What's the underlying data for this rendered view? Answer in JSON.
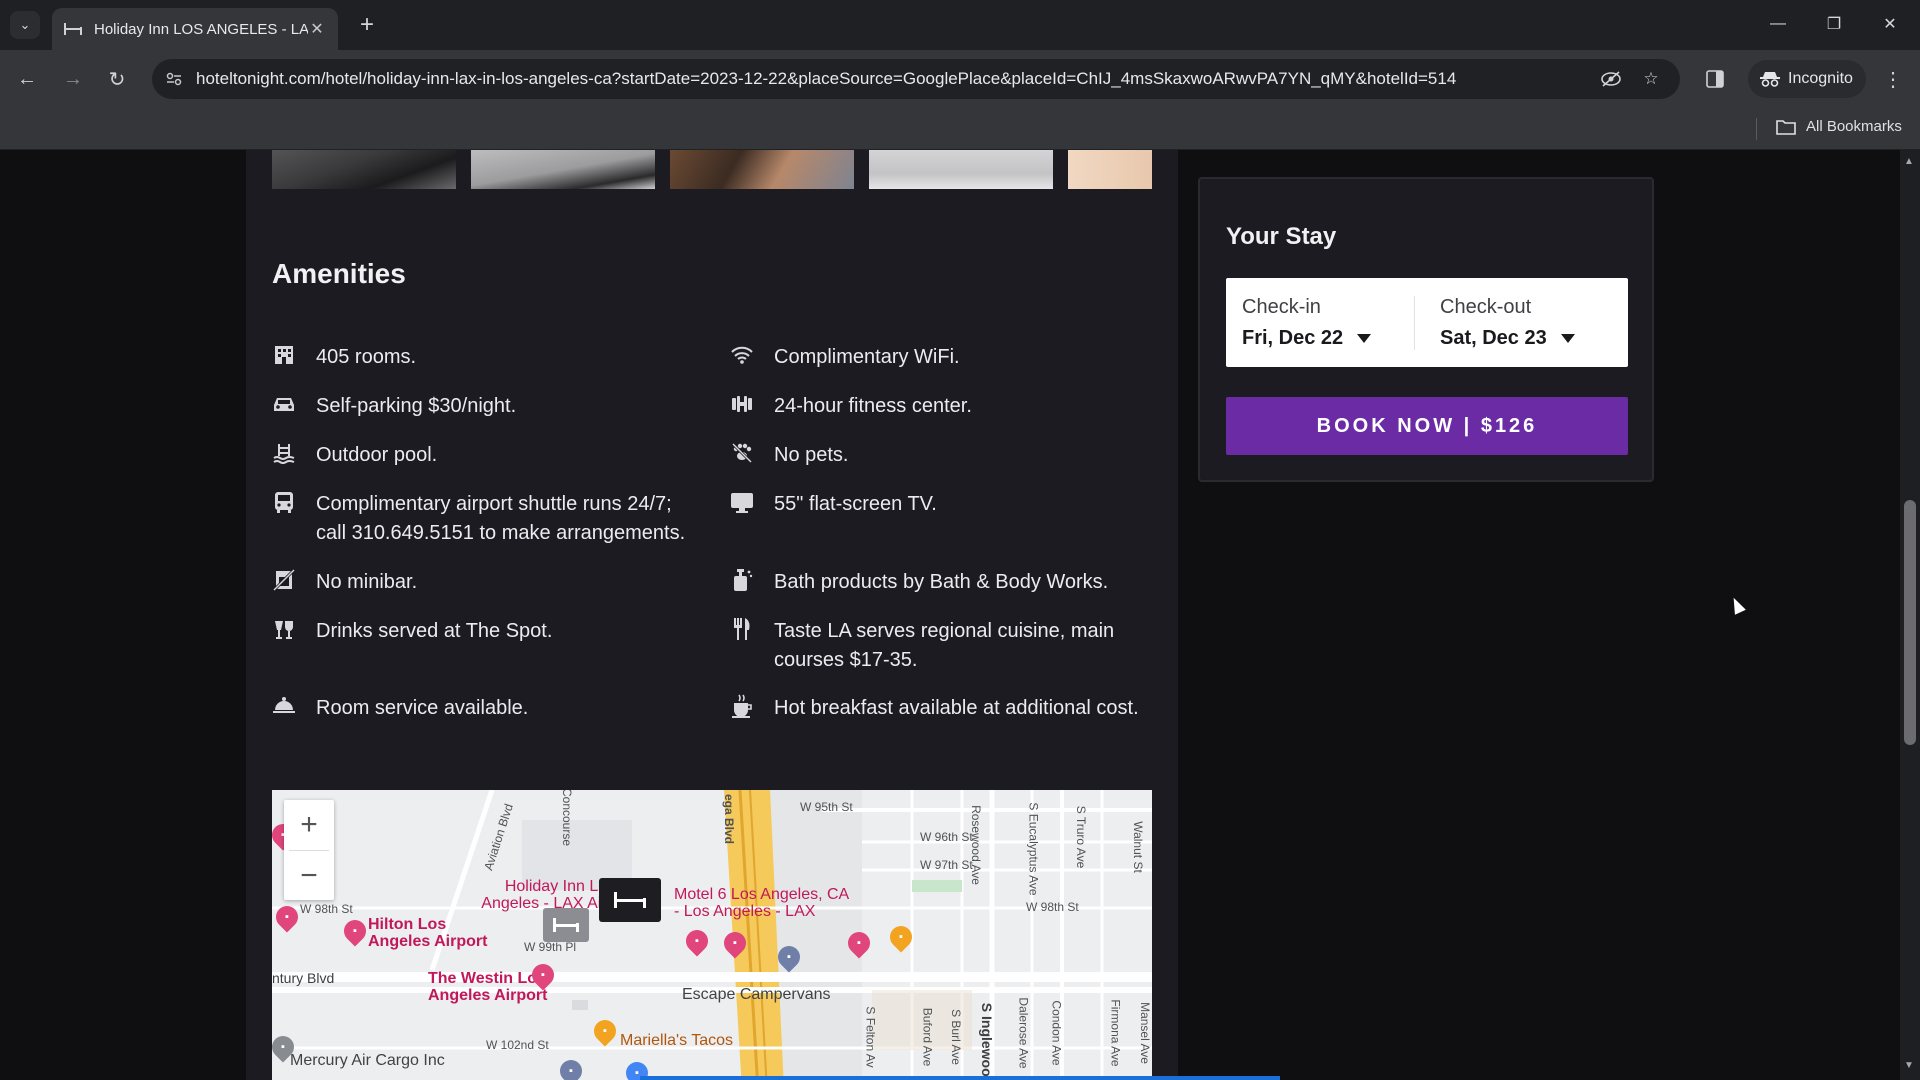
{
  "browser": {
    "tab_title": "Holiday Inn LOS ANGELES - LA",
    "url": "hoteltonight.com/hotel/holiday-inn-lax-in-los-angeles-ca?startDate=2023-12-22&placeSource=GooglePlace&placeId=ChIJ_4msSkaxwoARwvPA7YN_qMY&hotelId=514",
    "incognito_label": "Incognito",
    "all_bookmarks_label": "All Bookmarks"
  },
  "amenities": {
    "title": "Amenities",
    "items": [
      {
        "text": "405 rooms.",
        "icon": "building-icon"
      },
      {
        "text": "Complimentary WiFi.",
        "icon": "wifi-icon"
      },
      {
        "text": "Self-parking $30/night.",
        "icon": "car-icon"
      },
      {
        "text": "24-hour fitness center.",
        "icon": "dumbbell-icon"
      },
      {
        "text": "Outdoor pool.",
        "icon": "pool-icon"
      },
      {
        "text": "No pets.",
        "icon": "no-pets-icon"
      },
      {
        "text": "Complimentary airport shuttle runs 24/7; call 310.649.5151 to make arrangements.",
        "icon": "bus-icon"
      },
      {
        "text": "55\" flat-screen TV.",
        "icon": "tv-icon"
      },
      {
        "text": "No minibar.",
        "icon": "no-minibar-icon"
      },
      {
        "text": "Bath products by Bath & Body Works.",
        "icon": "soap-bottle-icon"
      },
      {
        "text": "Drinks served at The Spot.",
        "icon": "drinks-icon"
      },
      {
        "text": "Taste LA serves regional cuisine, main courses $17-35.",
        "icon": "fork-knife-icon"
      },
      {
        "text": "Room service available.",
        "icon": "cloche-icon"
      },
      {
        "text": "Hot breakfast available at additional cost.",
        "icon": "coffee-icon"
      }
    ]
  },
  "map": {
    "streets": [
      "Aviation Blvd",
      "Concourse",
      "ega Blvd",
      "W 95th St",
      "W 96th St",
      "W 97th St",
      "Rosewood Ave",
      "S Eucalyptus Ave",
      "S Truro Ave",
      "Walnut St",
      "W 98th St",
      "W 98th St",
      "W 99th Pl",
      "ntury Blvd",
      "W 102nd St",
      "S Felton Av",
      "Buford Ave",
      "S Burl Ave",
      "S Inglewood",
      "Dalerose Ave",
      "Condon Ave",
      "Firmona Ave",
      "Mansel Ave"
    ],
    "pois": {
      "holiday_inn": "Holiday Inn Los Angeles - LAX Airport, a",
      "motel6": "Motel 6 Los Angeles, CA - Los Angeles - LAX",
      "hilton": "Hilton Los Angeles Airport",
      "westin": "The Westin Los Angeles Airport",
      "escape": "Escape Campervans",
      "mariellas": "Mariella's Tacos",
      "mercury": "Mercury Air Cargo Inc"
    }
  },
  "stay": {
    "title": "Your Stay",
    "checkin_label": "Check-in",
    "checkin_value": "Fri, Dec 22",
    "checkout_label": "Check-out",
    "checkout_value": "Sat, Dec 23",
    "book_label": "BOOK NOW | $126"
  }
}
